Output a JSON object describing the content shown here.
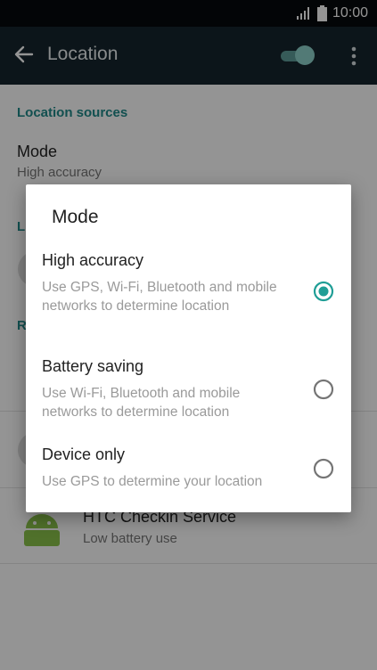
{
  "status_bar": {
    "time": "10:00"
  },
  "toolbar": {
    "title": "Location",
    "master_switch_on": true
  },
  "background": {
    "section_sources": "Location sources",
    "mode_title": "Mode",
    "mode_summary": "High accuracy",
    "truncated_header_1": "L",
    "truncated_header_2": "R",
    "app_title": "HTC Checkin Service",
    "app_summary": "Low battery use"
  },
  "dialog": {
    "title": "Mode",
    "options": [
      {
        "label": "High accuracy",
        "description": "Use GPS, Wi-Fi, Bluetooth and mobile networks to determine location",
        "selected": true
      },
      {
        "label": "Battery saving",
        "description": "Use Wi-Fi, Bluetooth and mobile networks to determine location",
        "selected": false
      },
      {
        "label": "Device only",
        "description": "Use GPS to determine your location",
        "selected": false
      }
    ]
  },
  "colors": {
    "accent": "#1f9e96",
    "toolbar": "#16252d",
    "statusbar": "#060a0d"
  }
}
